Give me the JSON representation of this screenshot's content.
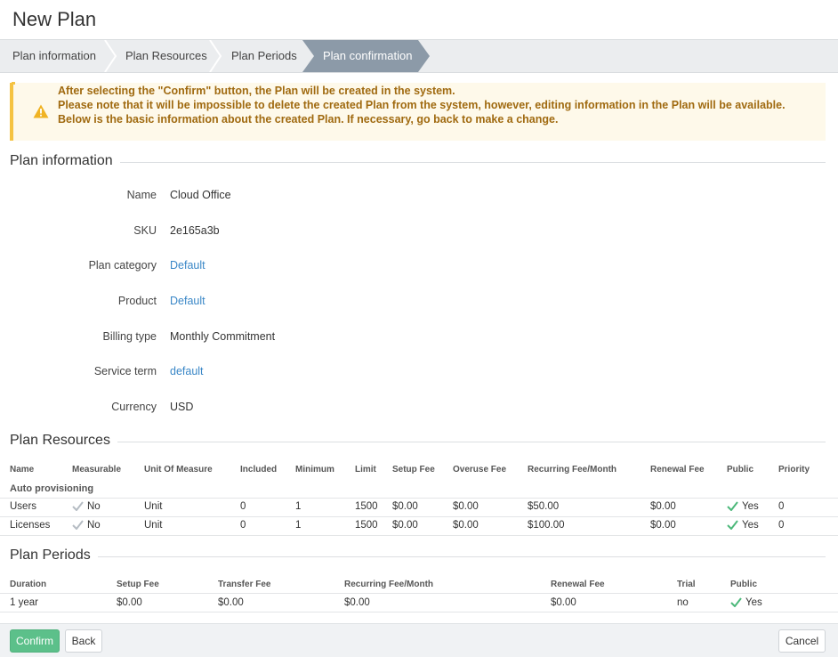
{
  "page_title": "New Plan",
  "wizard": {
    "steps": [
      {
        "label": "Plan information"
      },
      {
        "label": "Plan Resources"
      },
      {
        "label": "Plan Periods"
      },
      {
        "label": "Plan confirmation"
      }
    ],
    "active_step": 3
  },
  "alert": {
    "icon": "warning-triangle-icon",
    "line1": "After selecting the \"Confirm\" button, the Plan will be created in the system.",
    "line2": "Please note that it will be impossible to delete the created Plan from the system, however, editing information in the Plan will be available.",
    "line3": "Below is the basic information about the created Plan. If necessary, go back to make a change."
  },
  "plan_information": {
    "title": "Plan information",
    "fields": [
      {
        "label": "Name",
        "value": "Cloud Office",
        "link": false
      },
      {
        "label": "SKU",
        "value": "2e165a3b",
        "link": false
      },
      {
        "label": "Plan category",
        "value": "Default",
        "link": true
      },
      {
        "label": "Product",
        "value": "Default",
        "link": true
      },
      {
        "label": "Billing type",
        "value": "Monthly Commitment",
        "link": false
      },
      {
        "label": "Service term",
        "value": "default",
        "link": true
      },
      {
        "label": "Currency",
        "value": "USD",
        "link": false
      }
    ]
  },
  "plan_resources": {
    "title": "Plan Resources",
    "headers": [
      "Name",
      "Measurable",
      "Unit Of Measure",
      "Included",
      "Minimum",
      "Limit",
      "Setup Fee",
      "Overuse Fee",
      "Recurring Fee/Month",
      "Renewal Fee",
      "Public",
      "Priority"
    ],
    "group": "Auto provisioning",
    "rows": [
      {
        "name": "Users",
        "measurable": "No",
        "unit": "Unit",
        "included": "0",
        "minimum": "1",
        "limit": "1500",
        "setup_fee": "$0.00",
        "overuse_fee": "$0.00",
        "recurring_fee": "$50.00",
        "renewal_fee": "$0.00",
        "public": "Yes",
        "priority": "0"
      },
      {
        "name": "Licenses",
        "measurable": "No",
        "unit": "Unit",
        "included": "0",
        "minimum": "1",
        "limit": "1500",
        "setup_fee": "$0.00",
        "overuse_fee": "$0.00",
        "recurring_fee": "$100.00",
        "renewal_fee": "$0.00",
        "public": "Yes",
        "priority": "0"
      }
    ]
  },
  "plan_periods": {
    "title": "Plan Periods",
    "headers": [
      "Duration",
      "Setup Fee",
      "Transfer Fee",
      "Recurring Fee/Month",
      "Renewal Fee",
      "Trial",
      "Public"
    ],
    "rows": [
      {
        "duration": "1 year",
        "setup_fee": "$0.00",
        "transfer_fee": "$0.00",
        "recurring_fee": "$0.00",
        "renewal_fee": "$0.00",
        "trial": "no",
        "public": "Yes"
      }
    ]
  },
  "footer": {
    "confirm_label": "Confirm",
    "back_label": "Back",
    "cancel_label": "Cancel"
  },
  "colors": {
    "accent_link": "#3a87c7",
    "confirm_green": "#5cc08a",
    "check_green": "#4cb87a",
    "check_grey": "#b5bcc3",
    "active_step": "#8c9aa8",
    "warning": "#f5c342"
  }
}
